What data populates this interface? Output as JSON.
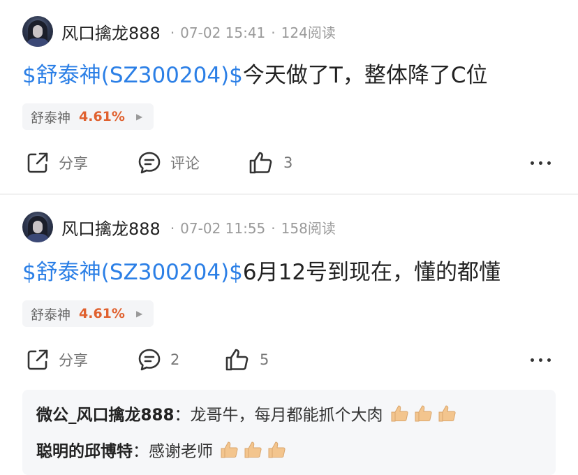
{
  "posts": [
    {
      "author": "风口擒龙888",
      "time": "07-02 15:41",
      "reads": "124阅读",
      "stock_tag": "$舒泰神(SZ300204)$",
      "text": "今天做了T，整体降了C位",
      "stock_name": "舒泰神",
      "stock_change": "4.61%",
      "share_label": "分享",
      "comment_label": "评论",
      "like_count": "3"
    },
    {
      "author": "风口擒龙888",
      "time": "07-02 11:55",
      "reads": "158阅读",
      "stock_tag": "$舒泰神(SZ300204)$",
      "text": "6月12号到现在，懂的都懂",
      "stock_name": "舒泰神",
      "stock_change": "4.61%",
      "share_label": "分享",
      "comment_count": "2",
      "like_count": "5",
      "comments": [
        {
          "user": "微公_风口擒龙888",
          "separator": "：",
          "text": "龙哥牛，每月都能抓个大肉"
        },
        {
          "user": "聪明的邱博特",
          "separator": "：",
          "text": "感谢老师"
        }
      ]
    }
  ],
  "icons": {
    "share": "share-icon",
    "comment": "comment-icon",
    "like": "thumbs-up-icon",
    "more": "more-icon",
    "emoji": "thumbs-up-emoji"
  },
  "colors": {
    "tag": "#2b7fe6",
    "change_up": "#e0612f",
    "meta": "#9a9a9a"
  }
}
